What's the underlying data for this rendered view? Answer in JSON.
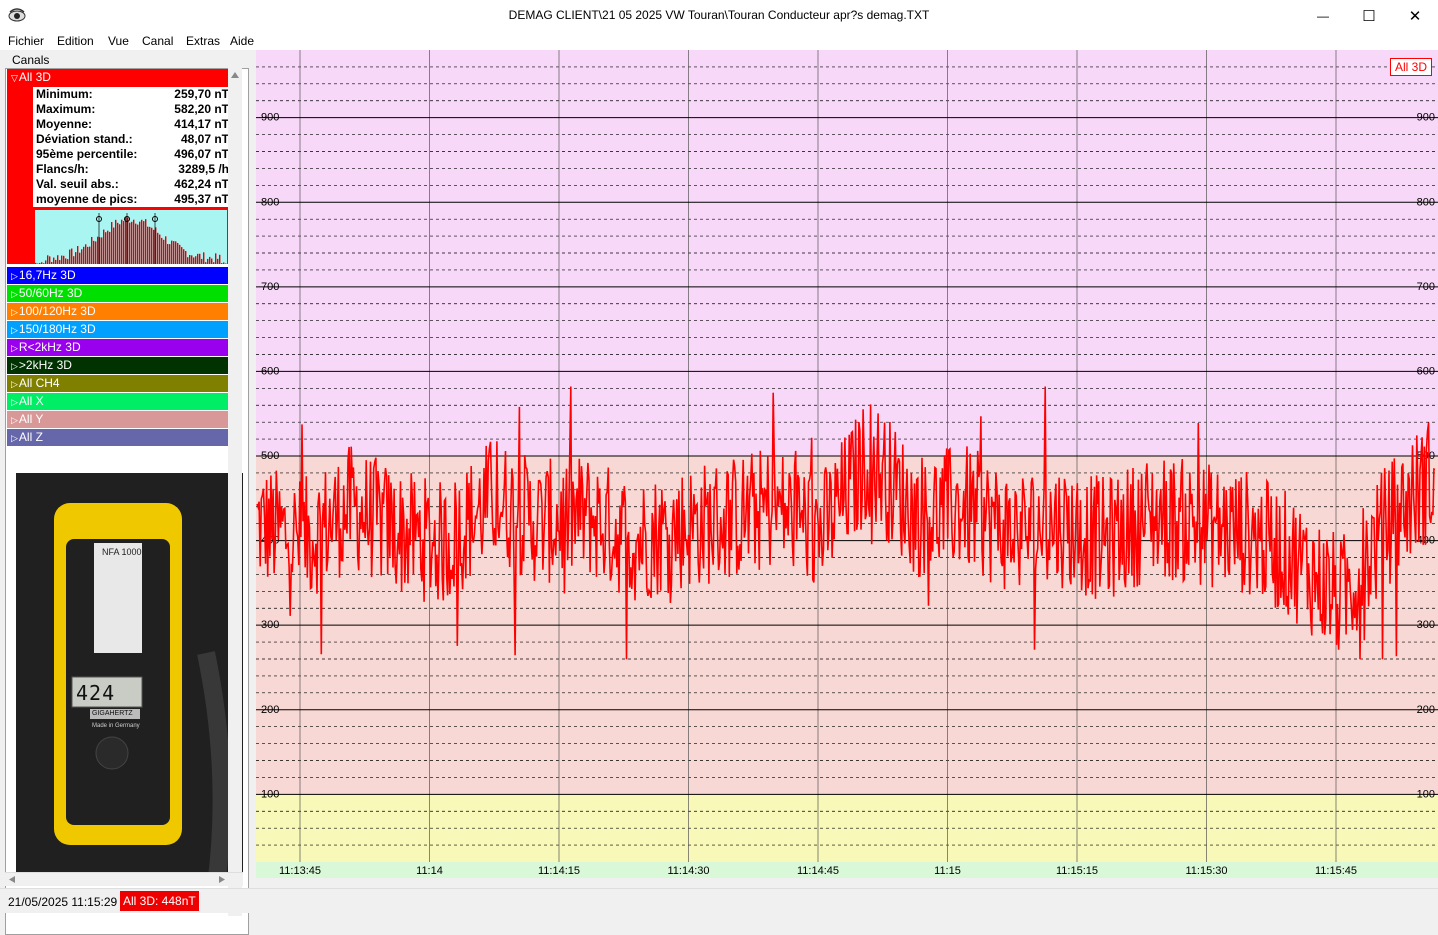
{
  "window": {
    "title": "DEMAG CLIENT\\21 05 2025 VW Touran\\Touran Conducteur apr?s demag.TXT",
    "minimize_glyph": "—",
    "maximize_glyph": "☐",
    "close_glyph": "✕"
  },
  "menu": [
    "Fichier",
    "Edition",
    "Vue",
    "Canal",
    "Extras",
    "Aide"
  ],
  "sidebar": {
    "label": "Canals",
    "active_channel": {
      "name": "All 3D",
      "color": "#ff0000",
      "stats": [
        {
          "label": "Minimum:",
          "value": "259,70 nT"
        },
        {
          "label": "Maximum:",
          "value": "582,20 nT"
        },
        {
          "label": "Moyenne:",
          "value": "414,17 nT"
        },
        {
          "label": "Déviation stand.:",
          "value": "48,07 nT"
        },
        {
          "label": "95ème percentile:",
          "value": "496,07 nT"
        },
        {
          "label": "Flancs/h:",
          "value": "3289,5 /h"
        },
        {
          "label": "Val. seuil abs.:",
          "value": "462,24 nT"
        },
        {
          "label": "moyenne de pics:",
          "value": "495,37 nT"
        }
      ]
    },
    "channels": [
      {
        "name": "16,7Hz 3D",
        "color": "#0000ff"
      },
      {
        "name": "50/60Hz 3D",
        "color": "#00e000"
      },
      {
        "name": "100/120Hz 3D",
        "color": "#ff7f00"
      },
      {
        "name": "150/180Hz 3D",
        "color": "#00a0ff"
      },
      {
        "name": "R<2kHz 3D",
        "color": "#9900ee"
      },
      {
        "name": ">2kHz 3D",
        "color": "#003300"
      },
      {
        "name": "All CH4",
        "color": "#808000"
      },
      {
        "name": "All X",
        "color": "#00ee66"
      },
      {
        "name": "All Y",
        "color": "#d89898"
      },
      {
        "name": "All Z",
        "color": "#6666aa"
      }
    ],
    "device_photo": {
      "model": "NFA 1000",
      "display_value": "424",
      "brand": "GIGAHERTZ",
      "made_in": "Made in Germany"
    }
  },
  "chart_data": {
    "type": "line",
    "title": "All 3D",
    "xlabel": "",
    "ylabel": "",
    "x_ticks": [
      "11:13:45",
      "11:14",
      "11:14:15",
      "11:14:30",
      "11:14:45",
      "11:15",
      "11:15:15",
      "11:15:30",
      "11:15:45"
    ],
    "y_ticks": [
      100,
      200,
      300,
      400,
      500,
      600,
      700,
      800,
      900
    ],
    "ylim": [
      20,
      980
    ],
    "bands": [
      {
        "from": 500,
        "to": 980,
        "color": "#f8d8f8"
      },
      {
        "from": 100,
        "to": 500,
        "color": "#f8d8d4"
      },
      {
        "from": 20,
        "to": 100,
        "color": "#f8f8b8"
      }
    ],
    "grid": true,
    "series": [
      {
        "color": "#ff0000",
        "x": [
          0,
          0.04,
          0.08,
          0.12,
          0.16,
          0.2,
          0.24,
          0.28,
          0.32,
          0.36,
          0.4,
          0.44,
          0.48,
          0.52,
          0.56,
          0.6,
          0.64,
          0.68,
          0.72,
          0.76,
          0.8,
          0.84,
          0.88,
          0.92,
          0.96,
          1.0
        ],
        "values": [
          420,
          400,
          440,
          410,
          395,
          450,
          420,
          430,
          400,
          415,
          425,
          440,
          410,
          500,
          430,
          440,
          410,
          420,
          400,
          430,
          420,
          410,
          380,
          330,
          420,
          480
        ],
        "min": 259.7,
        "max": 582.2
      }
    ]
  },
  "status": {
    "datetime": "21/05/2025 11:15:29",
    "current": "All 3D: 448nT"
  },
  "colors": {
    "accent_red": "#ff0000",
    "histogram_bg": "#a9f5f2"
  }
}
